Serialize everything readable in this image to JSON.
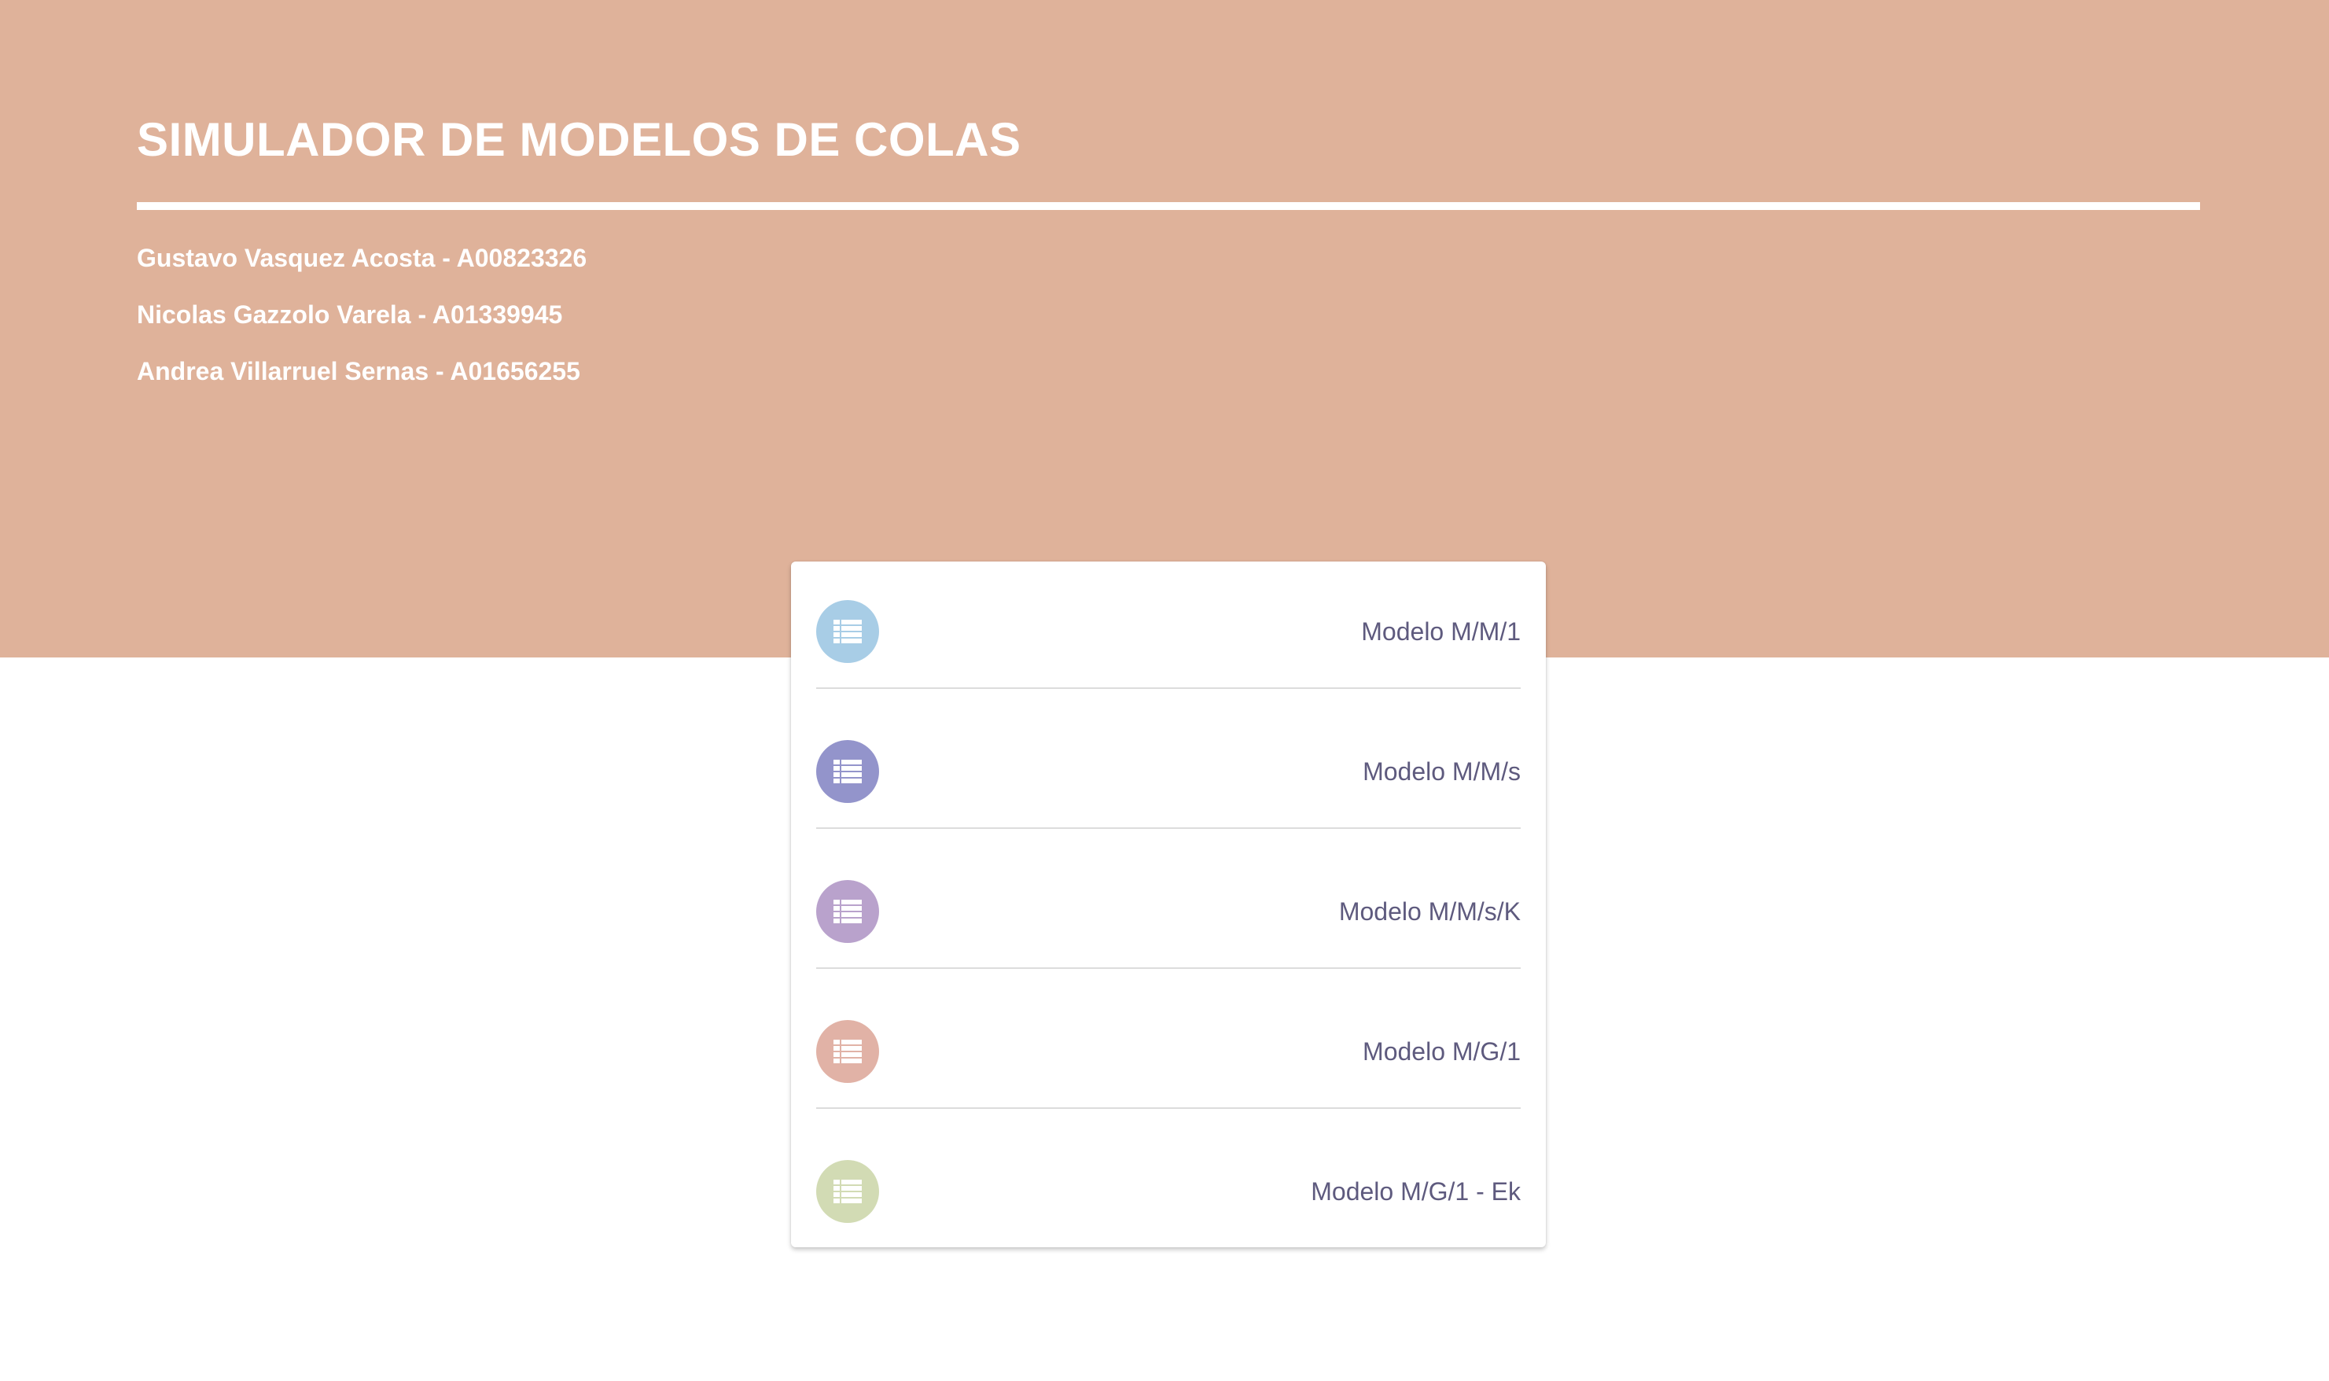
{
  "header": {
    "title": "SIMULADOR DE MODELOS DE COLAS",
    "authors": [
      "Gustavo Vasquez Acosta - A00823326",
      "Nicolas Gazzolo Varela - A01339945",
      "Andrea Villarruel Sernas - A01656255"
    ]
  },
  "models": {
    "items": [
      {
        "label": "Modelo M/M/1",
        "icon": "list-icon",
        "color": "#a8cde6"
      },
      {
        "label": "Modelo M/M/s",
        "icon": "list-icon",
        "color": "#9394cb"
      },
      {
        "label": "Modelo M/M/s/K",
        "icon": "list-icon",
        "color": "#b9a2cc"
      },
      {
        "label": "Modelo M/G/1",
        "icon": "list-icon",
        "color": "#e1b2a6"
      },
      {
        "label": "Modelo M/G/1 - Ek",
        "icon": "list-icon",
        "color": "#d2dbb4"
      }
    ]
  },
  "colors": {
    "header_bg": "#dfb29a",
    "label_text": "#5e5a7e"
  }
}
